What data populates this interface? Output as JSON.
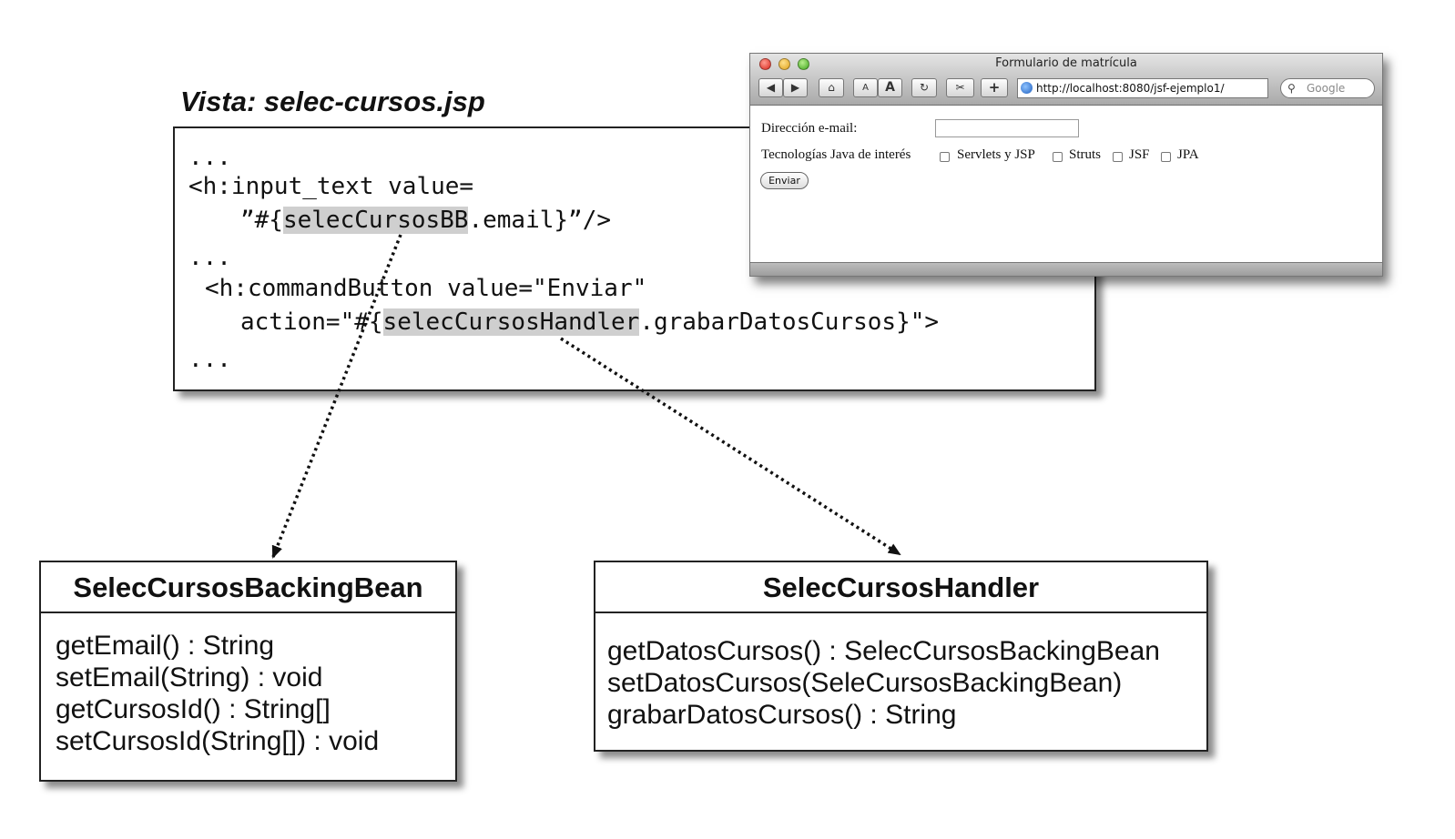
{
  "view": {
    "title": "Vista: selec-cursos.jsp"
  },
  "code": {
    "line1": "...",
    "line2": "<h:input_text value=",
    "line3_pre": "”#{",
    "line3_hl": "selecCursosBB",
    "line3_post": ".email}”/>",
    "line4": "...",
    "line5": "<h:commandButton value=\"Enviar\"",
    "line6_pre": "action=\"#{",
    "line6_hl": "selecCursosHandler",
    "line6_post": ".grabarDatosCursos}\">",
    "line7": "..."
  },
  "browser": {
    "window_title": "Formulario de matrícula",
    "url": "http://localhost:8080/jsf-ejemplo1/",
    "search_placeholder": "Google",
    "font_small": "A",
    "font_large": "A",
    "email_label": "Dirección e-mail:",
    "tech_label": "Tecnologías Java de interés",
    "options": [
      "Servlets y JSP",
      "Struts",
      "JSF",
      "JPA"
    ],
    "submit_label": "Enviar"
  },
  "backing_bean": {
    "name": "SelecCursosBackingBean",
    "methods": [
      "getEmail() : String",
      "setEmail(String) : void",
      "getCursosId() : String[]",
      "setCursosId(String[]) : void"
    ]
  },
  "handler": {
    "name": "SelecCursosHandler",
    "methods": [
      "getDatosCursos() : SelecCursosBackingBean",
      "setDatosCursos(SeleCursosBackingBean)",
      "grabarDatosCursos() : String"
    ]
  }
}
